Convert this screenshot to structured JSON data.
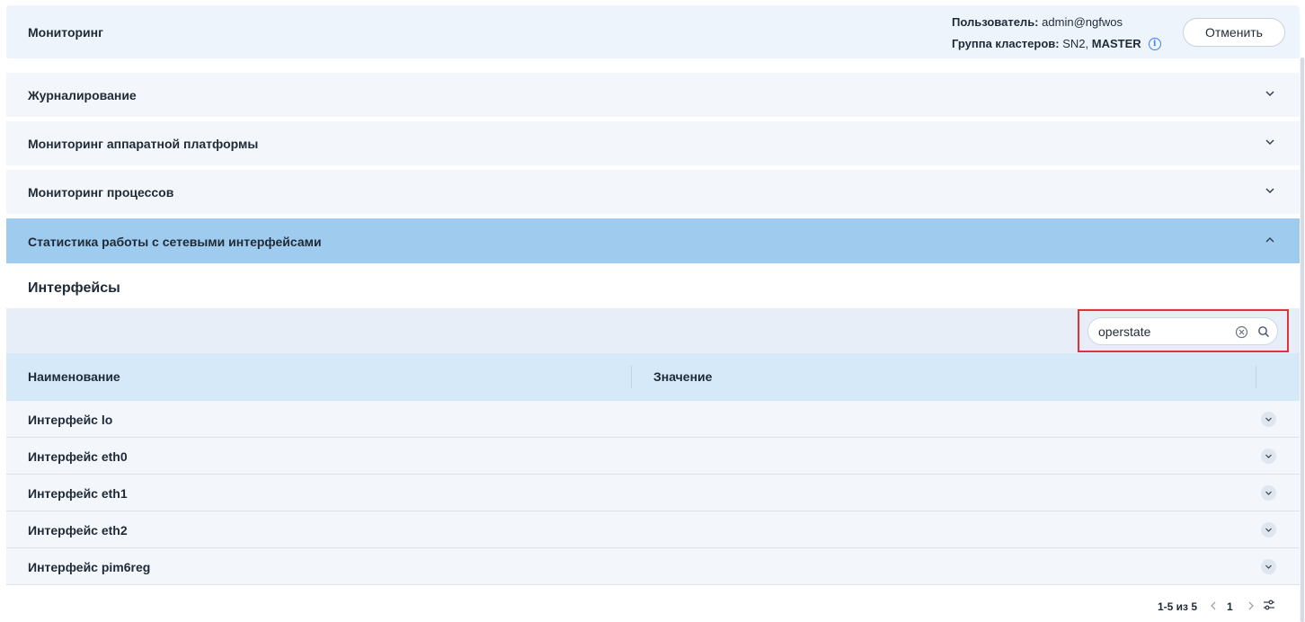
{
  "header": {
    "title": "Мониторинг",
    "user_label": "Пользователь:",
    "user_value": "admin@ngfwos",
    "cluster_label": "Группа кластеров:",
    "cluster_value": "SN2,",
    "cluster_role": "MASTER",
    "cancel_label": "Отменить"
  },
  "sections": [
    {
      "label": "Журналирование",
      "expanded": false
    },
    {
      "label": "Мониторинг аппаратной платформы",
      "expanded": false
    },
    {
      "label": "Мониторинг процессов",
      "expanded": false
    },
    {
      "label": "Статистика работы с сетевыми интерфейсами",
      "expanded": true
    }
  ],
  "panel": {
    "title": "Интерфейсы",
    "search": {
      "value": "operstate",
      "placeholder": ""
    }
  },
  "table": {
    "columns": [
      "Наименование",
      "Значение"
    ],
    "rows": [
      {
        "name": "Интерфейс lo"
      },
      {
        "name": "Интерфейс eth0"
      },
      {
        "name": "Интерфейс eth1"
      },
      {
        "name": "Интерфейс eth2"
      },
      {
        "name": "Интерфейс pim6reg"
      }
    ]
  },
  "pagination": {
    "range": "1-5 из 5",
    "page": "1"
  },
  "icons": {
    "info": "info-icon",
    "chevron_down": "chevron-down-icon",
    "chevron_up": "chevron-up-icon",
    "clear": "clear-icon",
    "search": "search-icon",
    "settings": "settings-sliders-icon"
  },
  "colors": {
    "header_bg": "#eef4fc",
    "active_section": "#9fcbee",
    "table_header": "#d6e9f9",
    "highlight_border": "#e0323c"
  }
}
